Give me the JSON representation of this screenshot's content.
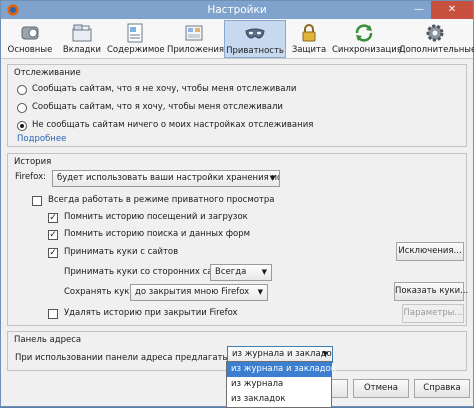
{
  "window": {
    "title": "Настройки",
    "minimize": "—",
    "close": "✕"
  },
  "toolbar": {
    "items": [
      {
        "label": "Основные",
        "icon": "switch-icon"
      },
      {
        "label": "Вкладки",
        "icon": "tabs-icon"
      },
      {
        "label": "Содержимое",
        "icon": "content-icon"
      },
      {
        "label": "Приложения",
        "icon": "applications-icon"
      },
      {
        "label": "Приватность",
        "icon": "privacy-mask-icon",
        "active": true
      },
      {
        "label": "Защита",
        "icon": "lock-icon"
      },
      {
        "label": "Синхронизация",
        "icon": "sync-icon"
      },
      {
        "label": "Дополнительные",
        "icon": "gear-icon"
      }
    ]
  },
  "tracking": {
    "title": "Отслеживание",
    "options": [
      "Сообщать сайтам, что я не хочу, чтобы меня отслеживали",
      "Сообщать сайтам, что я хочу, чтобы меня отслеживали",
      "Не сообщать сайтам ничего о моих настройках отслеживания"
    ],
    "selected_index": 2,
    "more_link": "Подробнее"
  },
  "history": {
    "title": "История",
    "firefox_label": "Firefox:",
    "firefox_mode": "будет использовать ваши настройки хранения истории",
    "private_mode": "Всегда работать в режиме приватного просмотра",
    "remember_visits": "Помнить историю посещений и загрузок",
    "remember_search": "Помнить историю поиска и данных форм",
    "accept_cookies": "Принимать куки с сайтов",
    "exceptions_button": "Исключения...",
    "third_party_label": "Принимать куки со сторонних сайтов:",
    "third_party_value": "Всегда",
    "keep_label": "Сохранять куки:",
    "keep_value": "до закрытия мною Firefox",
    "show_cookies_button": "Показать куки...",
    "clear_on_close": "Удалять историю при закрытии Firefox",
    "settings_button": "Параметры..."
  },
  "address_bar": {
    "title": "Панель адреса",
    "suggest_label": "При использовании панели адреса предлагать ссылки:",
    "suggest_value": "из журнала и закладок",
    "options": [
      "из журнала и закладок",
      "из журнала",
      "из закладок"
    ]
  },
  "footer": {
    "cancel": "Отмена",
    "help": "Справка"
  },
  "colors": {
    "accent": "#3c7fd0",
    "link": "#2a63b5",
    "close": "#c7503f"
  }
}
